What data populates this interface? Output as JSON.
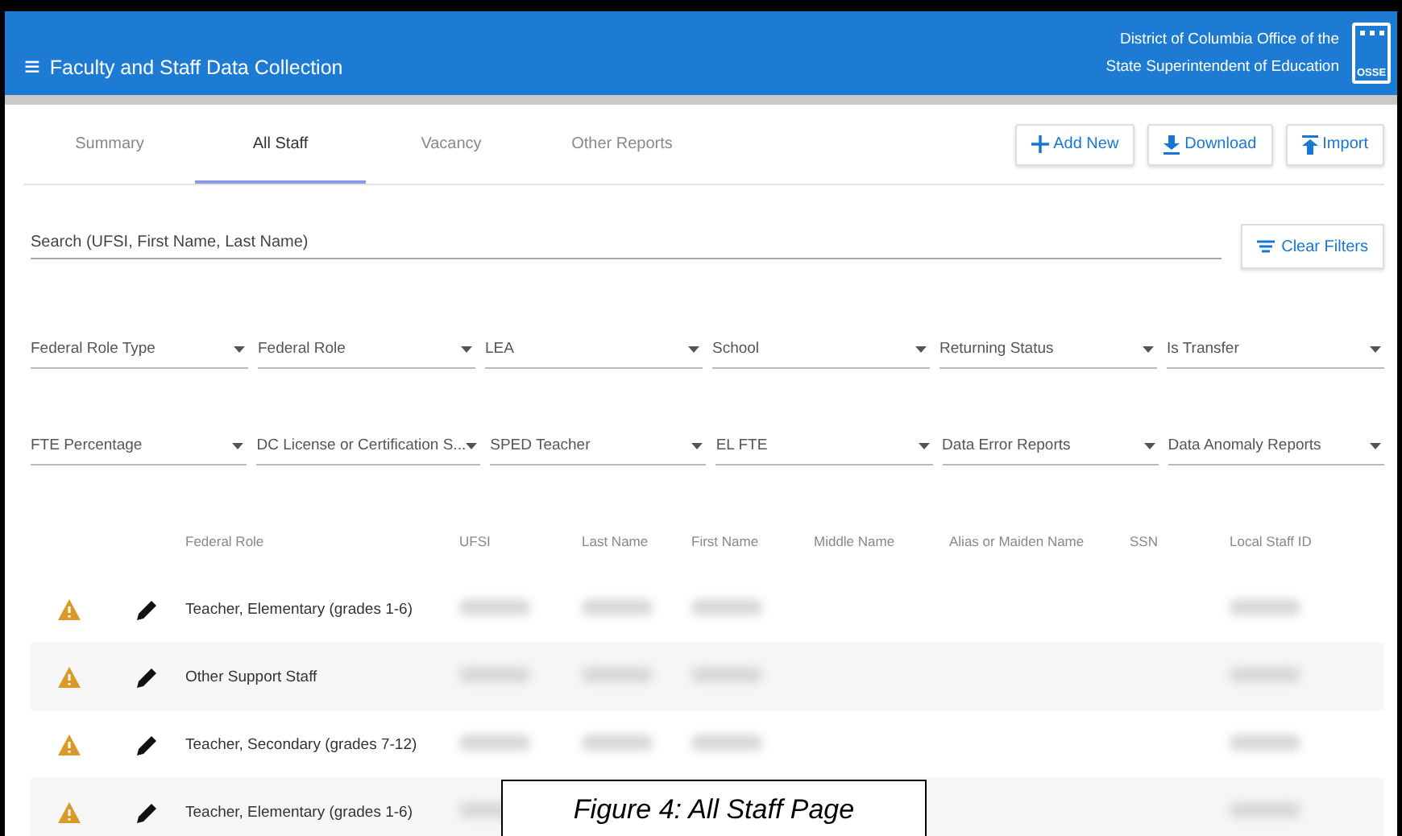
{
  "header": {
    "menu_glyph": "≡",
    "title": "Faculty and Staff Data Collection",
    "org_lines": [
      "District of Columbia Office of the",
      "State Superintendent of Education"
    ],
    "logo_text": "OSSE"
  },
  "tabs": [
    {
      "label": "Summary",
      "selected": false
    },
    {
      "label": "All Staff",
      "selected": true
    },
    {
      "label": "Vacancy",
      "selected": false
    },
    {
      "label": "Other Reports",
      "selected": false
    }
  ],
  "actions": [
    {
      "label": "Add New",
      "kind": "add"
    },
    {
      "label": "Download",
      "kind": "download"
    },
    {
      "label": "Import",
      "kind": "import"
    }
  ],
  "search": {
    "placeholder": "Search (UFSI, First Name, Last Name)"
  },
  "clear_filters": "Clear Filters",
  "filters": [
    [
      "Federal Role Type",
      "Federal Role",
      "LEA",
      "School",
      "Returning Status",
      "Is Transfer"
    ],
    [
      "FTE Percentage",
      "DC License or Certification S...",
      "SPED Teacher",
      "EL FTE",
      "Data Error Reports",
      "Data Anomaly Reports"
    ]
  ],
  "table": {
    "columns": [
      "Federal Role",
      "UFSI",
      "Last Name",
      "First Name",
      "Middle Name",
      "Alias or Maiden Name",
      "SSN",
      "Local Staff ID"
    ],
    "rows": [
      {
        "federal_role": "Teacher, Elementary (grades 1-6)",
        "warning": true,
        "redacted": [
          true,
          true,
          true,
          false,
          false,
          false,
          true
        ]
      },
      {
        "federal_role": "Other Support Staff",
        "warning": true,
        "redacted": [
          true,
          true,
          true,
          false,
          false,
          false,
          true
        ]
      },
      {
        "federal_role": "Teacher, Secondary (grades 7-12)",
        "warning": true,
        "redacted": [
          true,
          true,
          true,
          false,
          false,
          false,
          true
        ]
      },
      {
        "federal_role": "Teacher, Elementary (grades 1-6)",
        "warning": true,
        "redacted": [
          true,
          false,
          false,
          false,
          false,
          false,
          true
        ]
      }
    ]
  },
  "caption": "Figure 4: All Staff Page"
}
